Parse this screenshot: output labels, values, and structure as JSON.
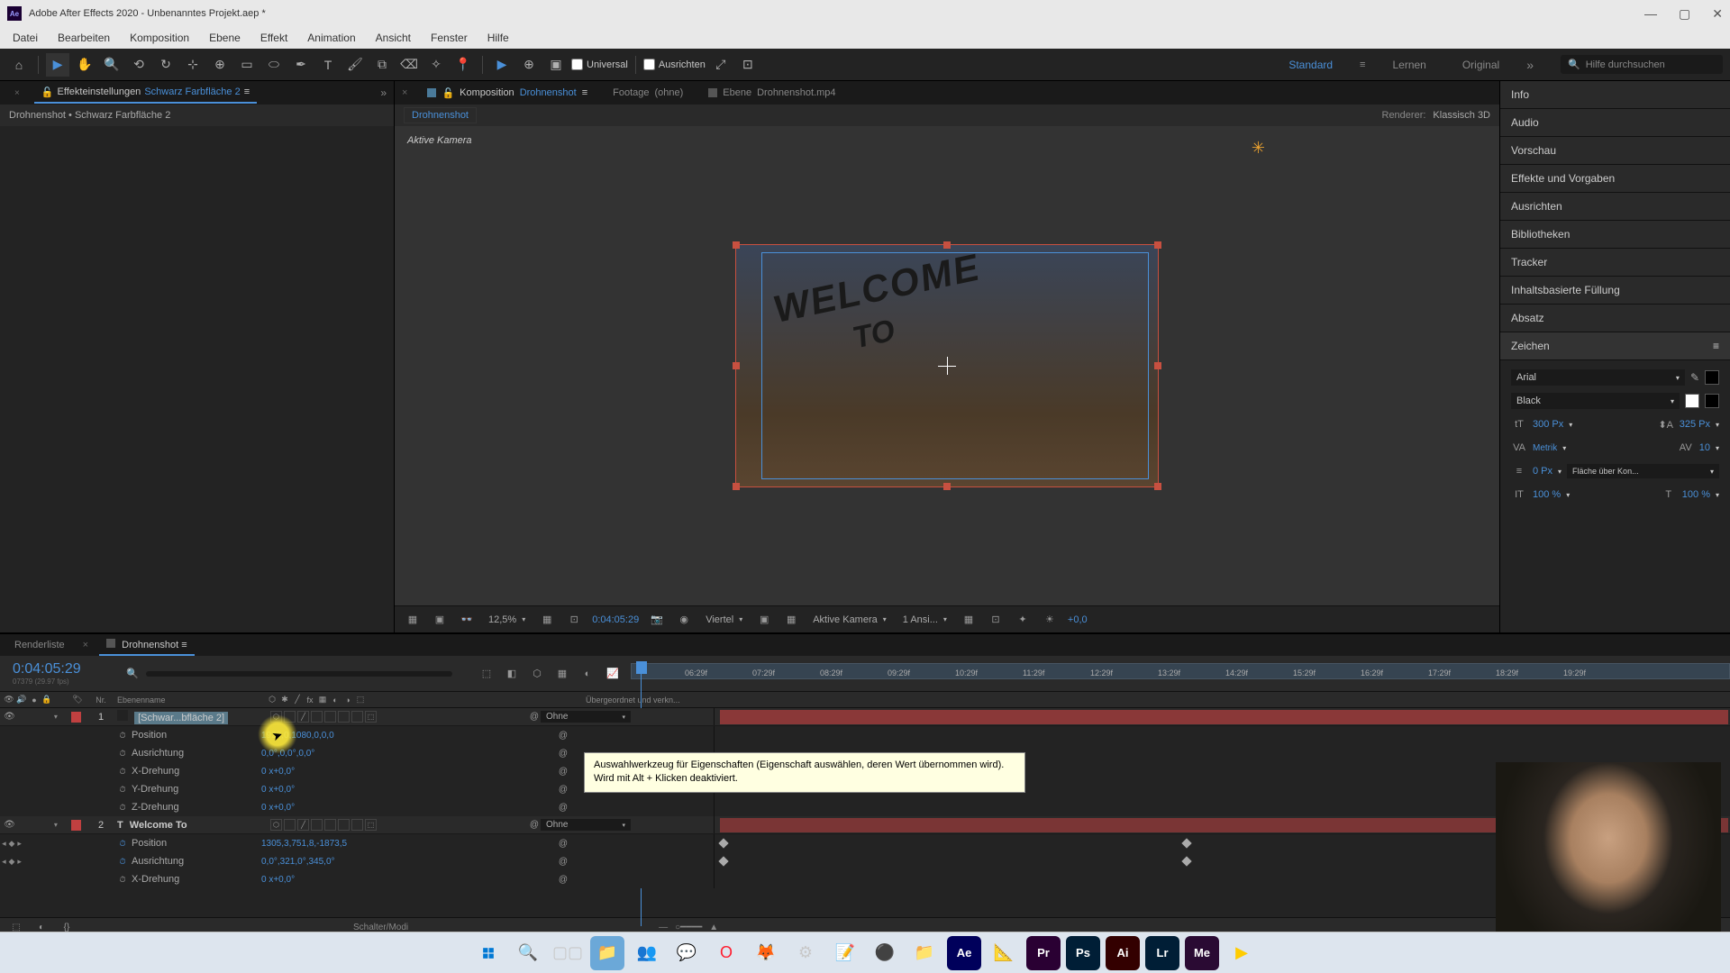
{
  "window": {
    "title": "Adobe After Effects 2020 - Unbenanntes Projekt.aep *"
  },
  "menu": {
    "items": [
      "Datei",
      "Bearbeiten",
      "Komposition",
      "Ebene",
      "Effekt",
      "Animation",
      "Ansicht",
      "Fenster",
      "Hilfe"
    ]
  },
  "toolbar": {
    "universal_label": "Universal",
    "align_label": "Ausrichten",
    "workspace_active": "Standard",
    "workspace_learn": "Lernen",
    "workspace_original": "Original",
    "search_placeholder": "Hilfe durchsuchen"
  },
  "left_panel": {
    "tab_effects": "Effekteinstellungen",
    "tab_effects_layer": "Schwarz Farbfläche 2",
    "breadcrumb": "Drohnenshot • Schwarz Farbfläche 2"
  },
  "comp_panel": {
    "tab_comp_prefix": "Komposition",
    "tab_comp_name": "Drohnenshot",
    "tab_footage": "Footage",
    "tab_footage_none": "(ohne)",
    "tab_layer_prefix": "Ebene",
    "tab_layer_name": "Drohnenshot.mp4",
    "crumb": "Drohnenshot",
    "renderer_label": "Renderer:",
    "renderer_value": "Klassisch 3D",
    "active_camera": "Aktive Kamera",
    "preview_text_1": "WELCOME",
    "preview_text_2": "TO"
  },
  "viewer_controls": {
    "zoom": "12,5%",
    "timecode": "0:04:05:29",
    "resolution": "Viertel",
    "camera": "Aktive Kamera",
    "views": "1 Ansi...",
    "exposure": "+0,0"
  },
  "right_panels": {
    "info": "Info",
    "audio": "Audio",
    "preview": "Vorschau",
    "effects_presets": "Effekte und Vorgaben",
    "align": "Ausrichten",
    "libraries": "Bibliotheken",
    "tracker": "Tracker",
    "content_fill": "Inhaltsbasierte Füllung",
    "paragraph": "Absatz",
    "character": "Zeichen"
  },
  "character": {
    "font": "Arial",
    "style": "Black",
    "size": "300 Px",
    "leading": "325 Px",
    "kerning": "Metrik",
    "tracking": "10",
    "stroke": "0 Px",
    "stroke_mode": "Fläche über Kon...",
    "vscale": "100 %",
    "hscale": "100 %"
  },
  "timeline": {
    "tab_render": "Renderliste",
    "tab_comp": "Drohnenshot",
    "current_time": "0:04:05:29",
    "current_frame": "07379 (29.97 fps)",
    "col_num": "Nr.",
    "col_name": "Ebenenname",
    "col_parent": "Übergeordnet und verkn...",
    "switches_label": "Schalter/Modi",
    "ticks": [
      "06:29f",
      "07:29f",
      "08:29f",
      "09:29f",
      "10:29f",
      "11:29f",
      "12:29f",
      "13:29f",
      "14:29f",
      "15:29f",
      "16:29f",
      "17:29f",
      "18:29f",
      "19:29f"
    ],
    "parent_none": "Ohne",
    "layers": [
      {
        "num": "1",
        "name": "[Schwar...bfläche 2]",
        "color": "#c04040",
        "props": [
          {
            "name": "Position",
            "value": "1920,0,1080,0,0,0"
          },
          {
            "name": "Ausrichtung",
            "value": "0,0°,0,0°,0,0°"
          },
          {
            "name": "X-Drehung",
            "value": "0 x+0,0°"
          },
          {
            "name": "Y-Drehung",
            "value": "0 x+0,0°"
          },
          {
            "name": "Z-Drehung",
            "value": "0 x+0,0°"
          }
        ]
      },
      {
        "num": "2",
        "name": "Welcome To",
        "color": "#c04040",
        "is_text": true,
        "props": [
          {
            "name": "Position",
            "value": "1305,3,751,8,-1873,5",
            "keyframed": true
          },
          {
            "name": "Ausrichtung",
            "value": "0,0°,321,0°,345,0°",
            "keyframed": true
          },
          {
            "name": "X-Drehung",
            "value": "0 x+0,0°"
          }
        ]
      }
    ]
  },
  "tooltip": {
    "text": "Auswahlwerkzeug für Eigenschaften (Eigenschaft auswählen, deren Wert übernommen wird). Wird mit Alt + Klicken deaktiviert."
  }
}
